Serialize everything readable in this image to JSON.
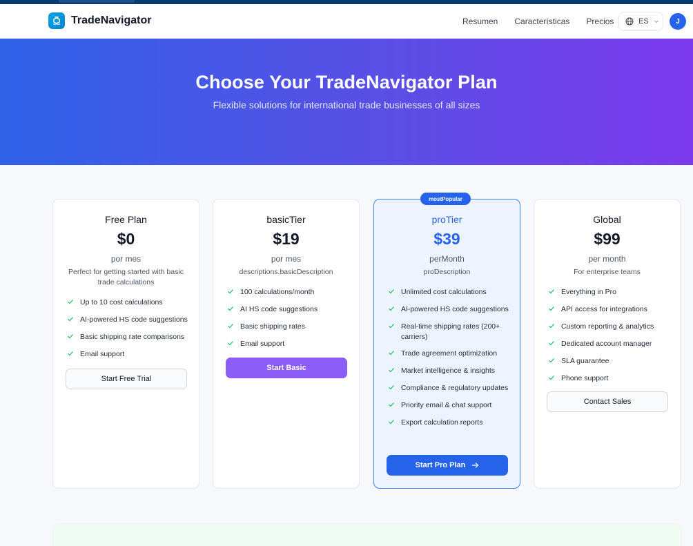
{
  "header": {
    "logo_text": "TradeNavigator",
    "nav": [
      "Resumen",
      "Características",
      "Precios"
    ],
    "language": "ES",
    "avatar_initial": "J",
    "brand_color": "#0ea5e9"
  },
  "hero": {
    "title": "Choose Your TradeNavigator Plan",
    "subtitle": "Flexible solutions for international trade businesses of all sizes"
  },
  "plans": [
    {
      "tier": "Free Plan",
      "price": "$0",
      "period": "por mes",
      "description": "Perfect for getting started with basic trade calculations",
      "features": [
        "Up to 10 cost calculations",
        "AI-powered HS code suggestions",
        "Basic shipping rate comparisons",
        "Email support"
      ],
      "button": "Start Free Trial"
    },
    {
      "tier": "basicTier",
      "price": "$19",
      "period": "por mes",
      "description": "descriptions.basicDescription",
      "features": [
        "100 calculations/month",
        "AI HS code suggestions",
        "Basic shipping rates",
        "Email support"
      ],
      "button": "Start Basic"
    },
    {
      "badge": "mostPopular",
      "tier": "proTier",
      "price": "$39",
      "period": "perMonth",
      "description": "proDescription",
      "features": [
        "Unlimited cost calculations",
        "AI-powered HS code suggestions",
        "Real-time shipping rates (200+ carriers)",
        "Trade agreement optimization",
        "Market intelligence & insights",
        "Compliance & regulatory updates",
        "Priority email & chat support",
        "Export calculation reports"
      ],
      "button": "Start Pro Plan"
    },
    {
      "tier": "Global",
      "price": "$99",
      "period": "per month",
      "description": "For enterprise teams",
      "features": [
        "Everything in Pro",
        "API access for integrations",
        "Custom reporting & analytics",
        "Dedicated account manager",
        "SLA guarantee",
        "Phone support"
      ],
      "button": "Contact Sales"
    }
  ],
  "colors": {
    "accent": "#2563eb",
    "basic_button": "#8b5cf6",
    "check": "#22c55e"
  }
}
